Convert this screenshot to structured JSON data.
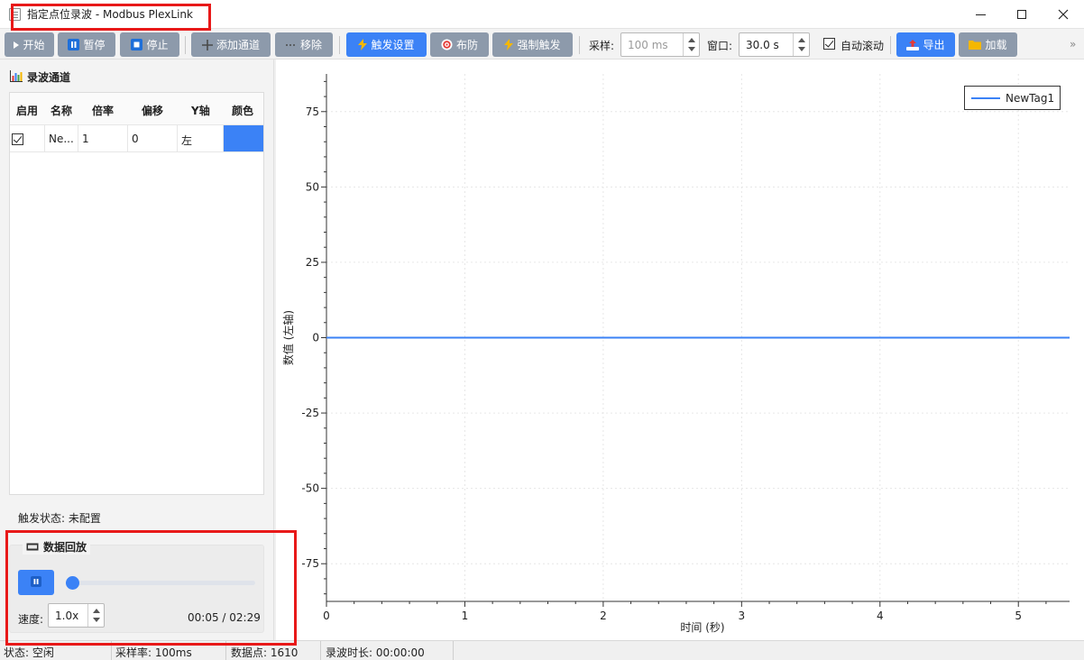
{
  "window": {
    "title": "指定点位录波 - Modbus PlexLink"
  },
  "toolbar": {
    "start": "开始",
    "pause": "暂停",
    "stop": "停止",
    "add_channel": "添加通道",
    "remove": "移除",
    "trigger_settings": "触发设置",
    "arm": "布防",
    "force_trigger": "强制触发",
    "sample_label": "采样:",
    "sample_value": "100 ms",
    "window_label": "窗口:",
    "window_value": "30.0 s",
    "auto_scroll": "自动滚动",
    "auto_scroll_checked": true,
    "export": "导出",
    "load": "加载",
    "overflow": "»"
  },
  "channels": {
    "title": "录波通道",
    "columns": [
      "启用",
      "名称",
      "倍率",
      "偏移",
      "Y轴",
      "颜色"
    ],
    "rows": [
      {
        "enabled": true,
        "name": "Ne...",
        "scale": "1",
        "offset": "0",
        "axis": "左",
        "color": "#3b82f6"
      }
    ]
  },
  "trigger_status": "触发状态: 未配置",
  "playback": {
    "title": "数据回放",
    "speed_label": "速度:",
    "speed_value": "1.0x",
    "time": "00:05 / 02:29",
    "progress": 0.034
  },
  "chart_data": {
    "type": "line",
    "title": "",
    "xlabel": "时间 (秒)",
    "ylabel": "数值 (左轴)",
    "xlim": [
      0,
      5.37
    ],
    "ylim": [
      -87.5,
      87.5
    ],
    "x_ticks": [
      0,
      1,
      2,
      3,
      4,
      5
    ],
    "y_ticks": [
      75,
      50,
      25,
      0,
      -25,
      -50,
      -75
    ],
    "grid": true,
    "legend_position": "top-right",
    "series": [
      {
        "name": "NewTag1",
        "color": "#3b82f6",
        "x": [
          0,
          5.37
        ],
        "y": [
          0,
          0
        ]
      }
    ]
  },
  "status": {
    "state": "状态: 空闲",
    "sample_rate": "采样率: 100ms",
    "data_points": "数据点: 1610",
    "duration": "录波时长: 00:00:00"
  }
}
